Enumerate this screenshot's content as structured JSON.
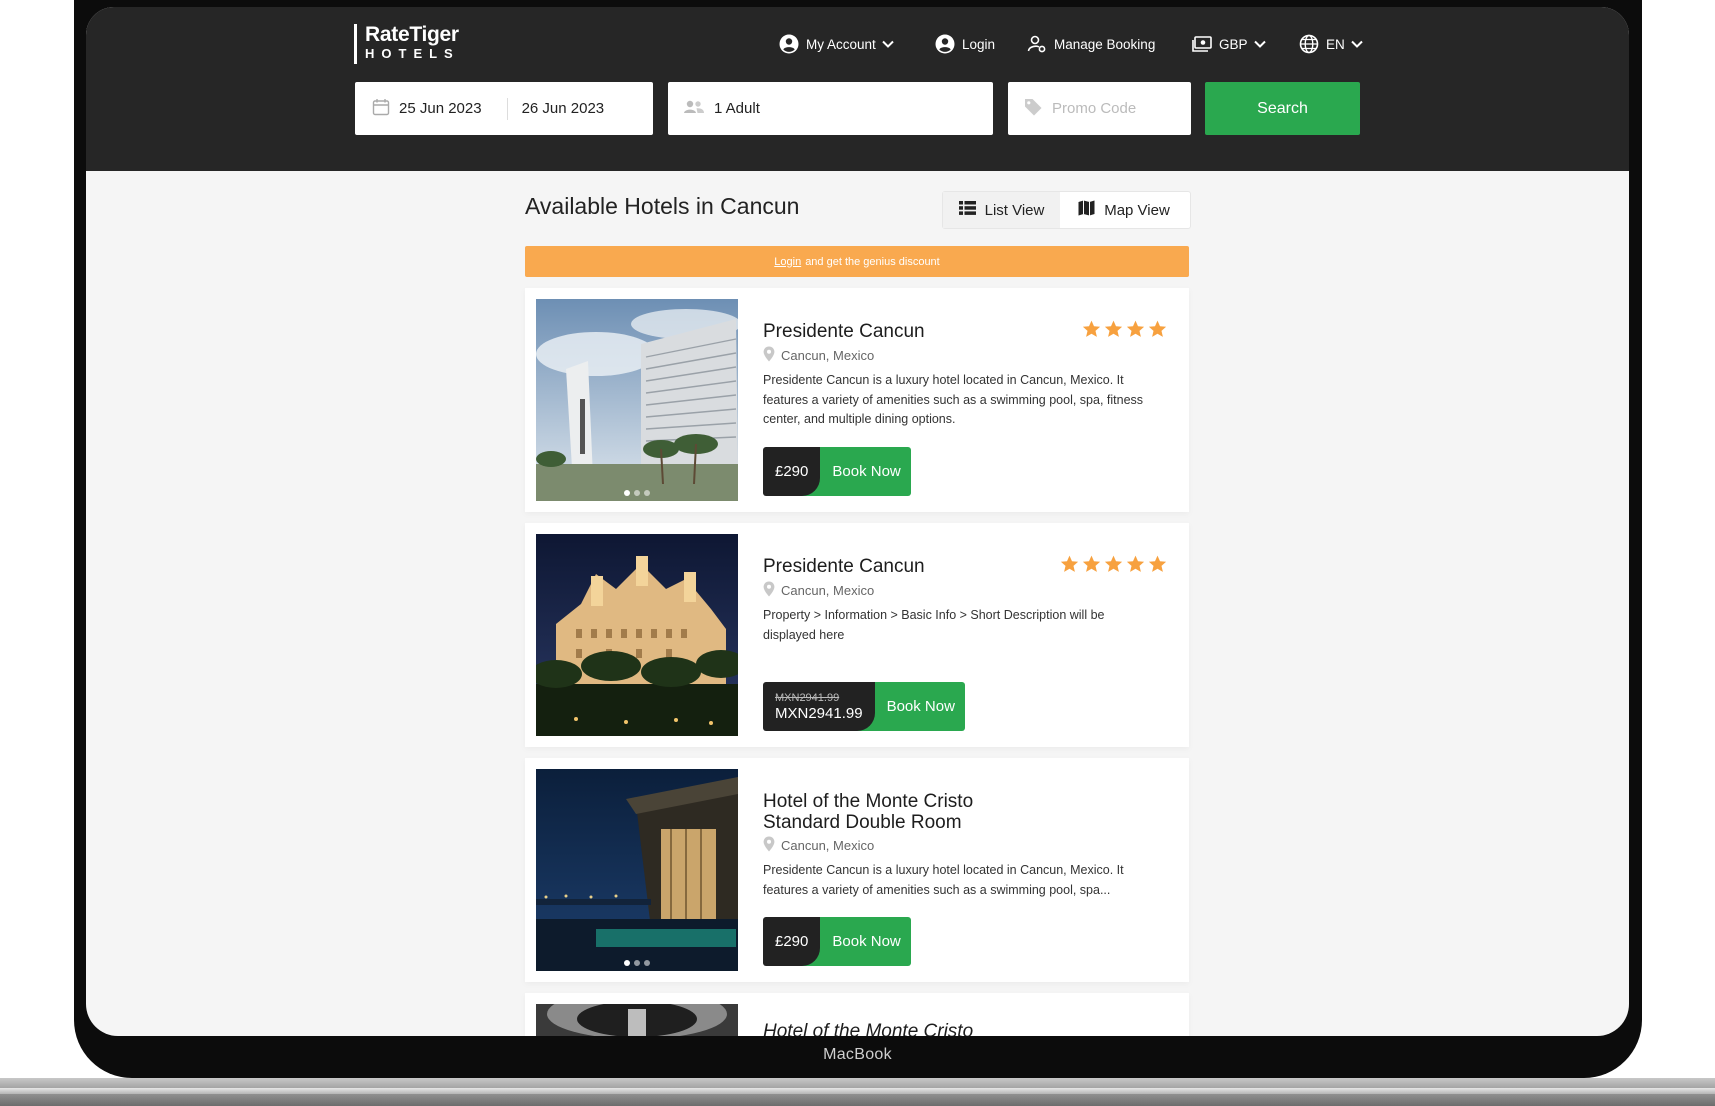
{
  "header": {
    "logo_main": "RateTiger",
    "logo_sub": "HOTELS",
    "nav": {
      "my_account": "My Account",
      "login": "Login",
      "manage_booking": "Manage Booking",
      "currency": "GBP",
      "language": "EN"
    },
    "search": {
      "check_in": "25 Jun 2023",
      "check_out": "26 Jun 2023",
      "guests": "1 Adult",
      "promo_placeholder": "Promo Code",
      "search_label": "Search"
    }
  },
  "main": {
    "title": "Available Hotels in Cancun",
    "list_view_label": "List View",
    "map_view_label": "Map View",
    "discount_banner": {
      "link": "Login",
      "text": "and get the genius discount"
    },
    "hotels": [
      {
        "name": "Presidente Cancun",
        "stars": 4,
        "location": "Cancun, Mexico",
        "description": "Presidente Cancun is a luxury hotel located in Cancun, Mexico. It features a variety of amenities such as a swimming pool, spa, fitness center, and multiple dining options.",
        "price": "£290",
        "book_label": "Book Now"
      },
      {
        "name": "Presidente Cancun",
        "stars": 5,
        "location": "Cancun, Mexico",
        "description": "Property > Information > Basic Info > Short Description will be displayed here",
        "old_price": "MXN2941.99",
        "price": "MXN2941.99",
        "book_label": "Book Now"
      },
      {
        "name": "Hotel of the Monte Cristo Standard Double Room",
        "location": "Cancun, Mexico",
        "description": "Presidente Cancun is a luxury hotel located in Cancun, Mexico. It features a variety of amenities such as a swimming pool, spa...",
        "price": "£290",
        "book_label": "Book Now"
      },
      {
        "name": "Hotel of the Monte Cristo"
      }
    ]
  },
  "device_label": "MacBook",
  "colors": {
    "header_bg": "#262626",
    "accent_green": "#2aa84f",
    "banner_orange": "#f9a94f",
    "star_orange": "#f7a13f",
    "page_bg": "#f5f5f5"
  },
  "icons": [
    "calendar-icon",
    "people-icon",
    "tag-icon",
    "user-circle-icon",
    "user-cog-icon",
    "currency-icon",
    "globe-icon",
    "list-icon",
    "map-icon",
    "location-pin-icon",
    "star-icon",
    "chevron-down-icon"
  ]
}
